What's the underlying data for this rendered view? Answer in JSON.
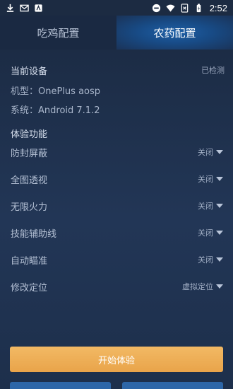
{
  "status_bar": {
    "time": "2:52",
    "left_icons": [
      "download-icon",
      "mail-icon",
      "app-icon"
    ],
    "right_icons": [
      "dnd-icon",
      "wifi-icon",
      "sim-icon",
      "battery-icon"
    ]
  },
  "tabs": [
    {
      "label": "吃鸡配置",
      "active": false
    },
    {
      "label": "农药配置",
      "active": true
    }
  ],
  "device": {
    "title": "当前设备",
    "status": "已检测",
    "model_line": "机型：OnePlus aosp",
    "system_line": "系统：Android 7.1.2"
  },
  "features": {
    "title": "体验功能",
    "items": [
      {
        "label": "防封屏蔽",
        "value": "关闭"
      },
      {
        "label": "全图透视",
        "value": "关闭"
      },
      {
        "label": "无限火力",
        "value": "关闭"
      },
      {
        "label": "技能辅助线",
        "value": "关闭"
      },
      {
        "label": "自动瞄准",
        "value": "关闭"
      },
      {
        "label": "修改定位",
        "value": "虚拟定位"
      }
    ]
  },
  "start_button": {
    "label": "开始体验"
  },
  "colors": {
    "background": "#1b2a41",
    "active_tab": "#1d5fa6",
    "start_button": "#f2b964",
    "bottom_button": "#2d66a8"
  }
}
